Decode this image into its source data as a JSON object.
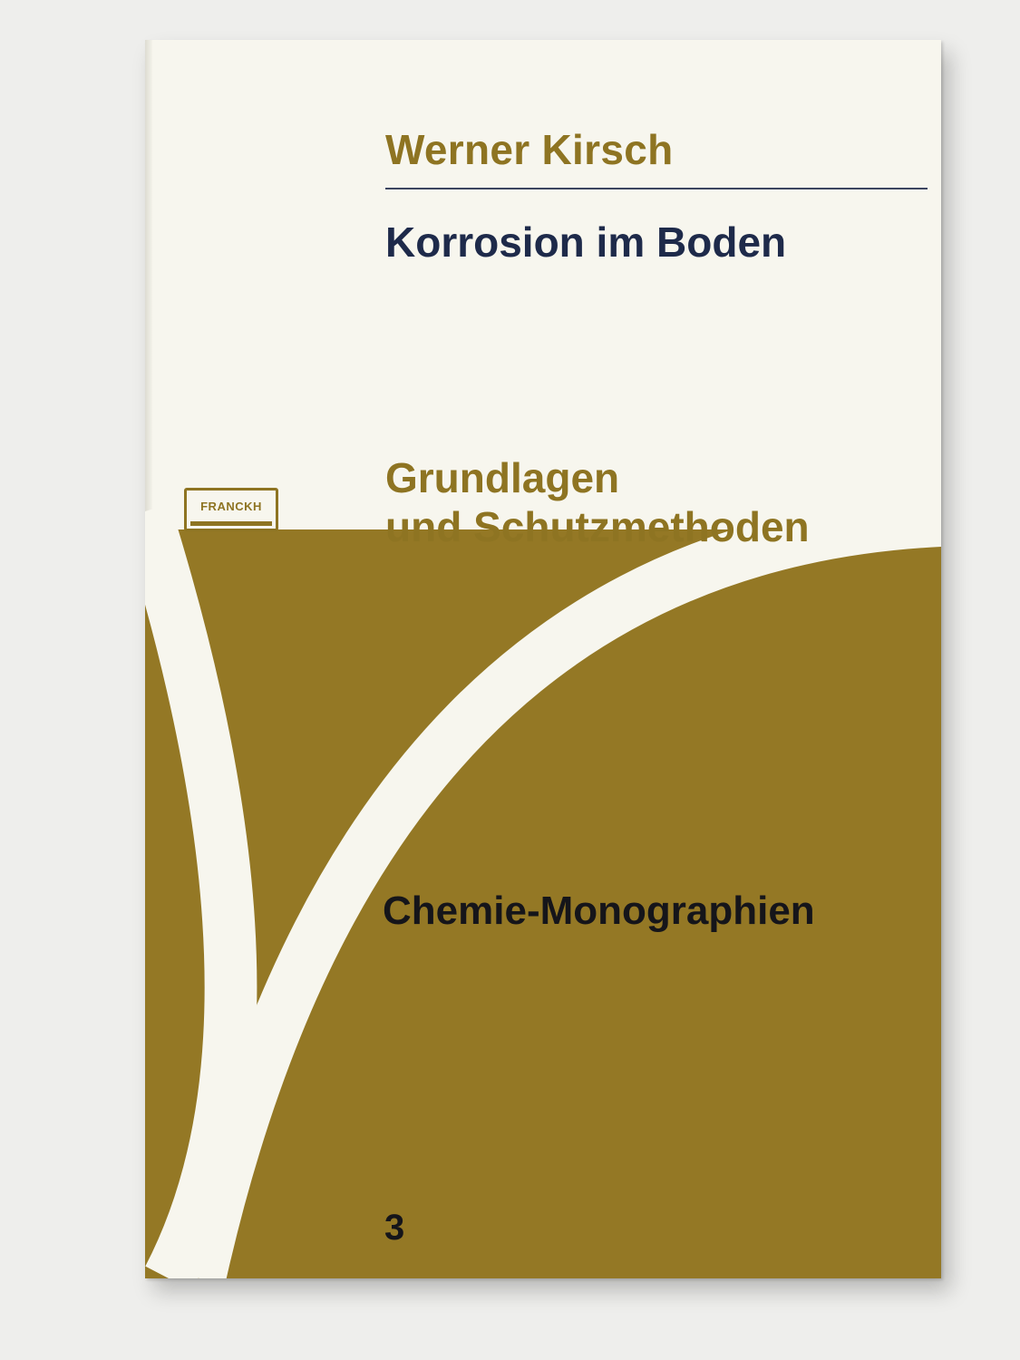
{
  "cover": {
    "author": "Werner Kirsch",
    "title": "Korrosion im Boden",
    "subtitle_line1": "Grundlagen",
    "subtitle_line2": "und Schutzmethoden",
    "series": "Chemie-Monographien",
    "volume": "3",
    "publisher_logo": "FRANCKH"
  },
  "colors": {
    "background": "#eeeeec",
    "paper": "#f7f6ee",
    "ochre": "#947825",
    "navy": "#1e2a4a",
    "black": "#15151a"
  }
}
